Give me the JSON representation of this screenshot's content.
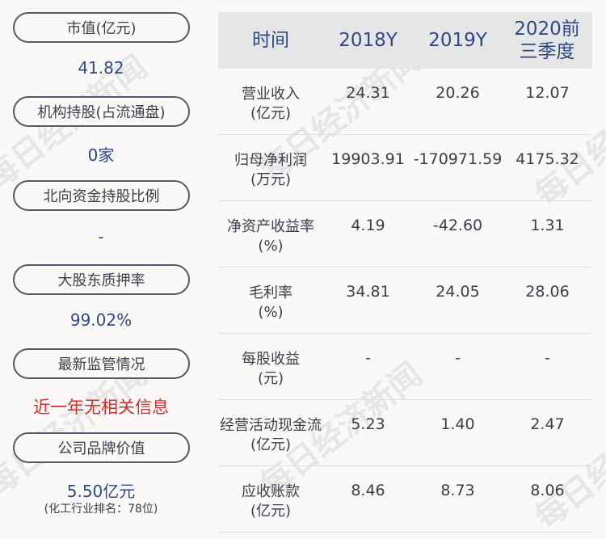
{
  "left": {
    "items": [
      {
        "label": "市值(亿元)",
        "value": "41.82"
      },
      {
        "label": "机构持股(占流通盘)",
        "value": "0家"
      },
      {
        "label": "北向资金持股比例",
        "value": "-"
      },
      {
        "label": "大股东质押率",
        "value": "99.02%"
      },
      {
        "label": "最新监管情况",
        "value": "近一年无相关信息"
      },
      {
        "label": "公司品牌价值",
        "value": "5.50亿元",
        "sub": "(化工行业排名：78位)"
      }
    ]
  },
  "table": {
    "headers": [
      "时间",
      "2018Y",
      "2019Y",
      "2020前三季度"
    ],
    "rows": [
      {
        "label": "营业收入\n(亿元)",
        "values": [
          "24.31",
          "20.26",
          "12.07"
        ]
      },
      {
        "label": "归母净利润\n(万元)",
        "values": [
          "19903.91",
          "-170971.59",
          "4175.32"
        ]
      },
      {
        "label": "净资产收益率\n(%)",
        "values": [
          "4.19",
          "-42.60",
          "1.31"
        ]
      },
      {
        "label": "毛利率\n(%)",
        "values": [
          "34.81",
          "24.05",
          "28.06"
        ]
      },
      {
        "label": "每股收益\n(元)",
        "values": [
          "-",
          "-",
          "-"
        ]
      },
      {
        "label": "经营活动现金流\n(亿元)",
        "values": [
          "5.23",
          "1.40",
          "2.47"
        ]
      },
      {
        "label": "应收账款\n(亿元)",
        "values": [
          "8.46",
          "8.73",
          "8.06"
        ]
      }
    ]
  },
  "watermark": "每日经济新闻",
  "colors": {
    "accent": "#2d4a86",
    "alert": "#d12f2f",
    "header_bg": "#e6e6e6"
  }
}
